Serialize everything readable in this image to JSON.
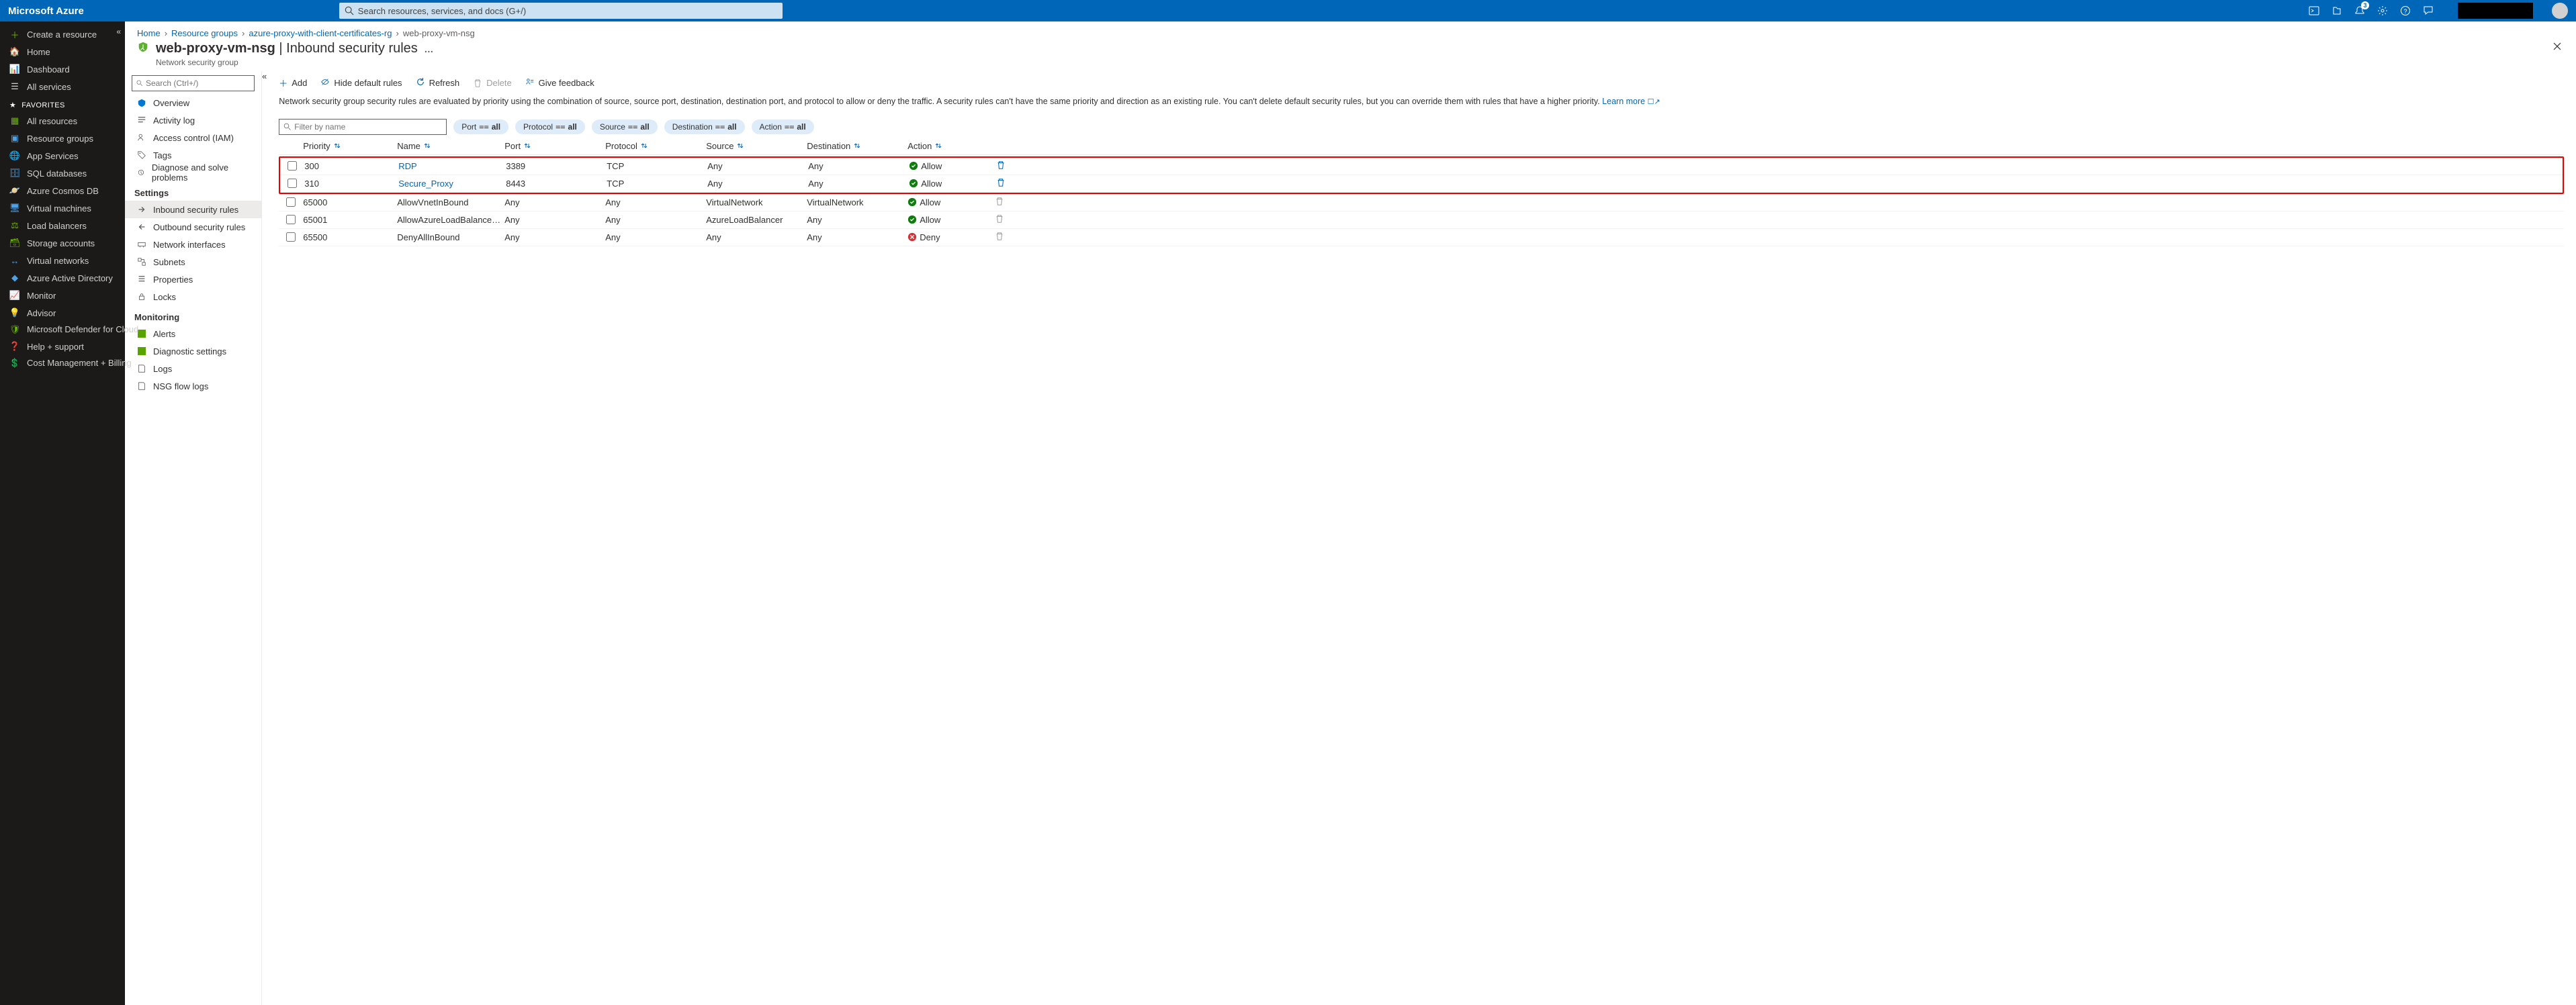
{
  "topbar": {
    "brand": "Microsoft Azure",
    "search_placeholder": "Search resources, services, and docs (G+/)",
    "notification_count": "3"
  },
  "leftnav": {
    "primary": [
      {
        "label": "Create a resource",
        "icon": "＋",
        "color": "#6bb700"
      },
      {
        "label": "Home",
        "icon": "🏠",
        "color": "#50a0e4"
      },
      {
        "label": "Dashboard",
        "icon": "📊",
        "color": "#50a0e4"
      },
      {
        "label": "All services",
        "icon": "☰",
        "color": "#d2d0ce"
      }
    ],
    "fav_header": "FAVORITES",
    "favorites": [
      {
        "label": "All resources",
        "icon": "▦",
        "color": "#6bb700"
      },
      {
        "label": "Resource groups",
        "icon": "▣",
        "color": "#50a0e4"
      },
      {
        "label": "App Services",
        "icon": "🌐",
        "color": "#50a0e4"
      },
      {
        "label": "SQL databases",
        "icon": "🗄",
        "color": "#50a0e4"
      },
      {
        "label": "Azure Cosmos DB",
        "icon": "🪐",
        "color": "#50a0e4"
      },
      {
        "label": "Virtual machines",
        "icon": "🖥",
        "color": "#50a0e4"
      },
      {
        "label": "Load balancers",
        "icon": "⚖",
        "color": "#6bb700"
      },
      {
        "label": "Storage accounts",
        "icon": "🗃",
        "color": "#6bb700"
      },
      {
        "label": "Virtual networks",
        "icon": "↔",
        "color": "#50a0e4"
      },
      {
        "label": "Azure Active Directory",
        "icon": "◆",
        "color": "#50a0e4"
      },
      {
        "label": "Monitor",
        "icon": "📈",
        "color": "#50a0e4"
      },
      {
        "label": "Advisor",
        "icon": "💡",
        "color": "#50a0e4"
      },
      {
        "label": "Microsoft Defender for Cloud",
        "icon": "🛡",
        "color": "#6bb700"
      },
      {
        "label": "Help + support",
        "icon": "❓",
        "color": "#50a0e4"
      },
      {
        "label": "Cost Management + Billing",
        "icon": "💲",
        "color": "#ffb900"
      }
    ]
  },
  "breadcrumb": [
    {
      "label": "Home"
    },
    {
      "label": "Resource groups"
    },
    {
      "label": "azure-proxy-with-client-certificates-rg"
    },
    {
      "label": "web-proxy-vm-nsg"
    }
  ],
  "page": {
    "title_resource": "web-proxy-vm-nsg",
    "title_section": "Inbound security rules",
    "subtitle": "Network security group"
  },
  "resmenu": {
    "search_placeholder": "Search (Ctrl+/)",
    "top": [
      {
        "label": "Overview"
      },
      {
        "label": "Activity log"
      },
      {
        "label": "Access control (IAM)"
      },
      {
        "label": "Tags"
      },
      {
        "label": "Diagnose and solve problems"
      }
    ],
    "settings_header": "Settings",
    "settings": [
      {
        "label": "Inbound security rules",
        "active": true
      },
      {
        "label": "Outbound security rules"
      },
      {
        "label": "Network interfaces"
      },
      {
        "label": "Subnets"
      },
      {
        "label": "Properties"
      },
      {
        "label": "Locks"
      }
    ],
    "monitoring_header": "Monitoring",
    "monitoring": [
      {
        "label": "Alerts"
      },
      {
        "label": "Diagnostic settings"
      },
      {
        "label": "Logs"
      },
      {
        "label": "NSG flow logs"
      }
    ]
  },
  "toolbar": {
    "add": "Add",
    "hide": "Hide default rules",
    "refresh": "Refresh",
    "delete": "Delete",
    "feedback": "Give feedback"
  },
  "info": {
    "text": "Network security group security rules are evaluated by priority using the combination of source, source port, destination, destination port, and protocol to allow or deny the traffic. A security rules can't have the same priority and direction as an existing rule. You can't delete default security rules, but you can override them with rules that have a higher priority.",
    "learn_more": "Learn more"
  },
  "filterbar": {
    "filter_placeholder": "Filter by name",
    "pills": [
      {
        "label": "Port",
        "value": "all"
      },
      {
        "label": "Protocol",
        "value": "all"
      },
      {
        "label": "Source",
        "value": "all"
      },
      {
        "label": "Destination",
        "value": "all"
      },
      {
        "label": "Action",
        "value": "all"
      }
    ]
  },
  "table": {
    "headers": {
      "priority": "Priority",
      "name": "Name",
      "port": "Port",
      "protocol": "Protocol",
      "source": "Source",
      "destination": "Destination",
      "action": "Action"
    },
    "highlighted_rows": [
      {
        "priority": "300",
        "name": "RDP",
        "port": "3389",
        "protocol": "TCP",
        "source": "Any",
        "destination": "Any",
        "action": "Allow",
        "deletable": true
      },
      {
        "priority": "310",
        "name": "Secure_Proxy",
        "port": "8443",
        "protocol": "TCP",
        "source": "Any",
        "destination": "Any",
        "action": "Allow",
        "deletable": true
      }
    ],
    "default_rows": [
      {
        "priority": "65000",
        "name": "AllowVnetInBound",
        "port": "Any",
        "protocol": "Any",
        "source": "VirtualNetwork",
        "destination": "VirtualNetwork",
        "action": "Allow",
        "deletable": false
      },
      {
        "priority": "65001",
        "name": "AllowAzureLoadBalancerInBound",
        "port": "Any",
        "protocol": "Any",
        "source": "AzureLoadBalancer",
        "destination": "Any",
        "action": "Allow",
        "deletable": false
      },
      {
        "priority": "65500",
        "name": "DenyAllInBound",
        "port": "Any",
        "protocol": "Any",
        "source": "Any",
        "destination": "Any",
        "action": "Deny",
        "deletable": false
      }
    ]
  }
}
